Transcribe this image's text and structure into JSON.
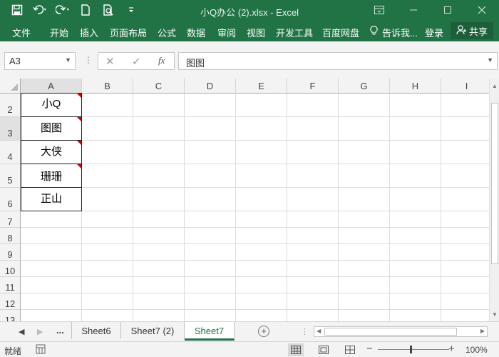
{
  "window": {
    "title": "小Q办公 (2).xlsx - Excel"
  },
  "ribbon": {
    "tabs": [
      "文件",
      "开始",
      "插入",
      "页面布局",
      "公式",
      "数据",
      "审阅",
      "视图",
      "开发工具",
      "百度网盘"
    ],
    "tell_me": "告诉我...",
    "login": "登录",
    "share": "共享"
  },
  "formula_bar": {
    "name_box": "A3",
    "fx_label": "fx",
    "content": "图图"
  },
  "sheet": {
    "columns": [
      "A",
      "B",
      "C",
      "D",
      "E",
      "F",
      "G",
      "H",
      "I"
    ],
    "rows": [
      "2",
      "3",
      "4",
      "5",
      "6",
      "7",
      "8",
      "9",
      "10",
      "11",
      "12",
      "13"
    ],
    "cells": [
      "小Q",
      "图图",
      "大侠",
      "珊珊",
      "正山"
    ],
    "selected_cell": "A3"
  },
  "sheet_tabs": {
    "more": "...",
    "tabs": [
      "Sheet6",
      "Sheet7 (2)",
      "Sheet7"
    ],
    "active": "Sheet7"
  },
  "status": {
    "ready": "就绪",
    "zoom": "100%"
  },
  "colors": {
    "accent": "#217346",
    "comment_marker": "#dd0000"
  }
}
